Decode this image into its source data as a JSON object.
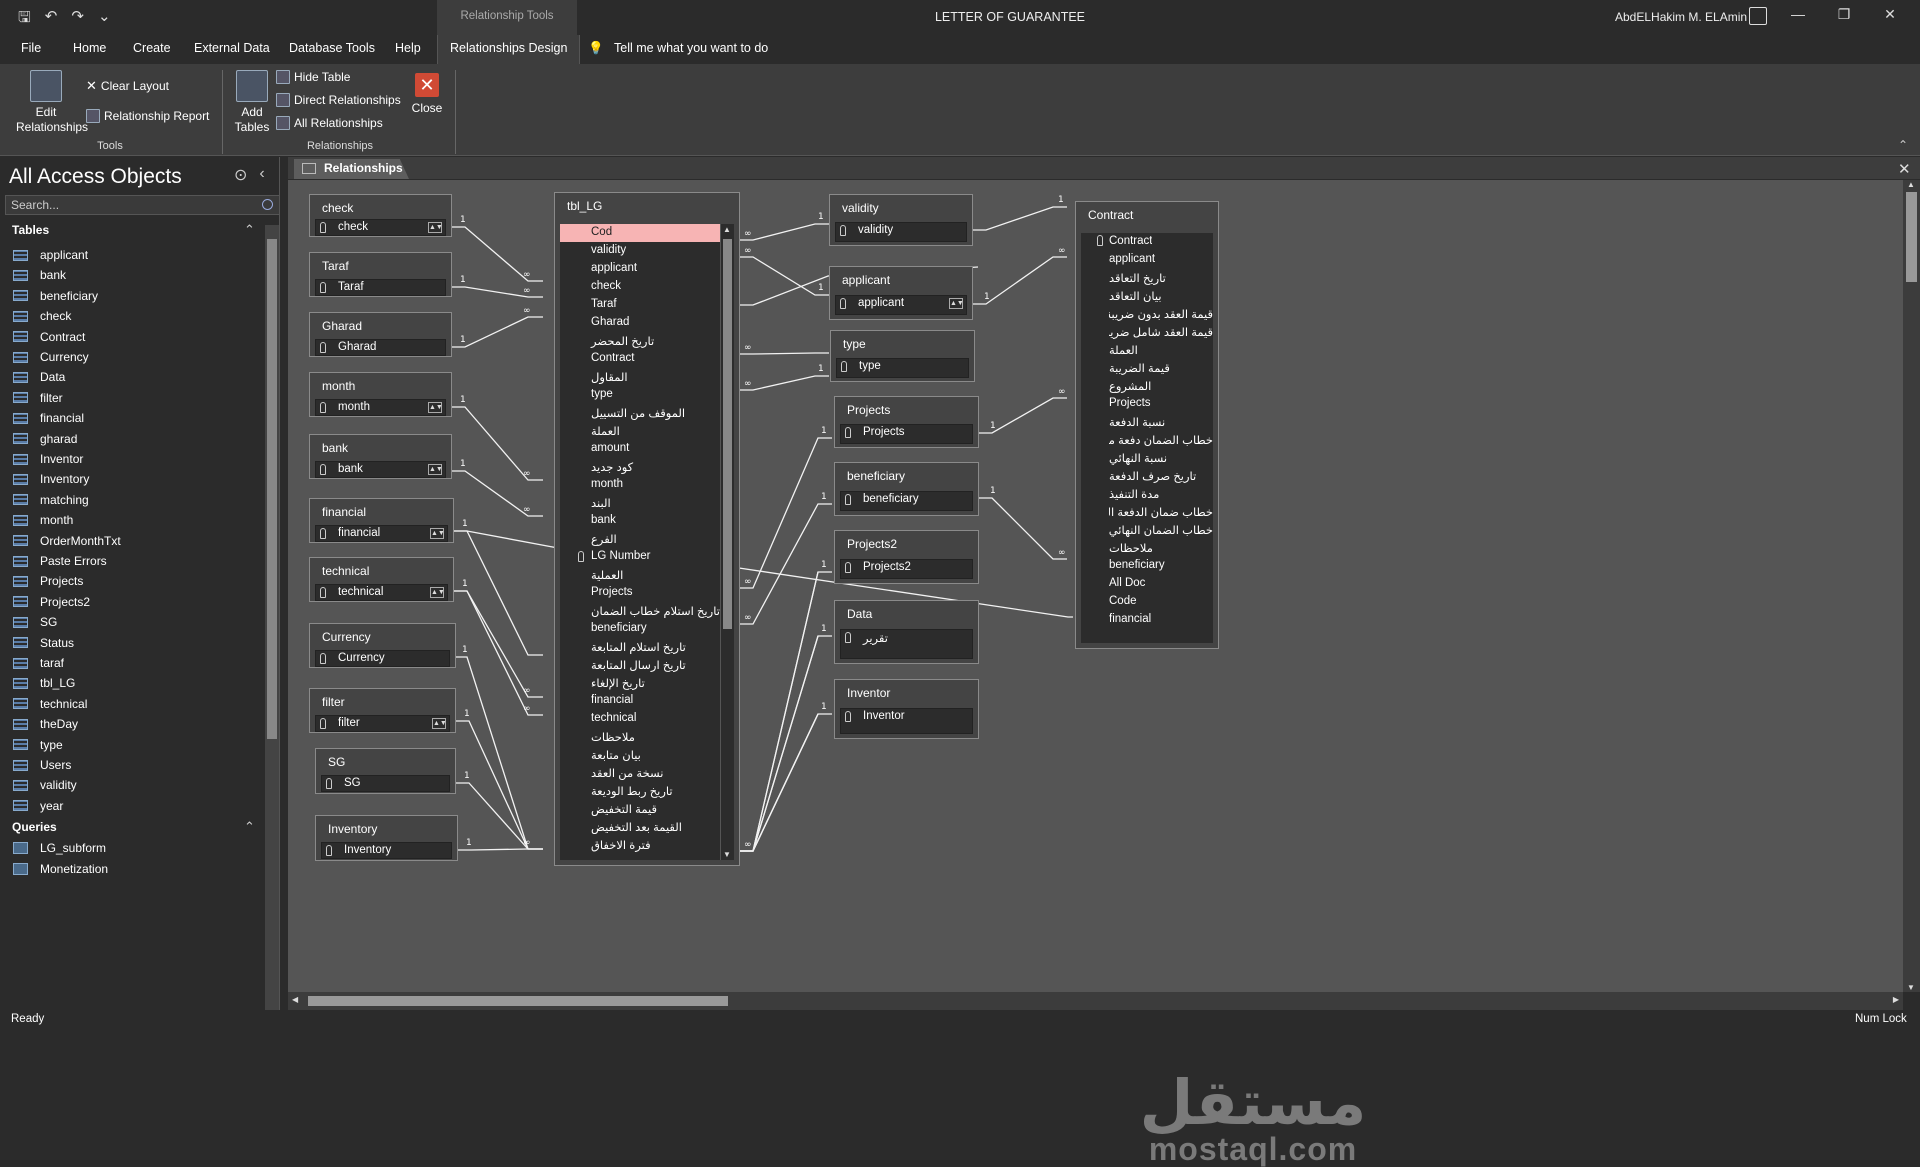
{
  "titlebar": {
    "contextual_tab": "Relationship Tools",
    "document_title": "LETTER OF GUARANTEE",
    "user_name": "AbdELHakim M. ELAmin"
  },
  "menu": {
    "items": [
      "File",
      "Home",
      "Create",
      "External Data",
      "Database Tools",
      "Help"
    ],
    "active": "Relationships Design",
    "tell_me": "Tell me what you want to do"
  },
  "ribbon": {
    "edit_relationships": "Edit Relationships",
    "clear_layout": "Clear Layout",
    "relationship_report": "Relationship Report",
    "tools_group": "Tools",
    "add_tables": "Add Tables",
    "hide_table": "Hide Table",
    "direct_relationships": "Direct Relationships",
    "all_relationships": "All Relationships",
    "close": "Close",
    "relationships_group": "Relationships"
  },
  "nav": {
    "title": "All Access Objects",
    "search_placeholder": "Search...",
    "tables_header": "Tables",
    "queries_header": "Queries",
    "tables": [
      "applicant",
      "bank",
      "beneficiary",
      "check",
      "Contract",
      "Currency",
      "Data",
      "filter",
      "financial",
      "gharad",
      "Inventor",
      "Inventory",
      "matching",
      "month",
      "OrderMonthTxt",
      "Paste Errors",
      "Projects",
      "Projects2",
      "SG",
      "Status",
      "taraf",
      "tbl_LG",
      "technical",
      "theDay",
      "type",
      "Users",
      "validity",
      "year"
    ],
    "queries": [
      "LG_subform",
      "Monetization"
    ]
  },
  "doc_tab": "Relationships",
  "boxes": {
    "check": {
      "title": "check",
      "field": "check"
    },
    "taraf": {
      "title": "Taraf",
      "field": "Taraf"
    },
    "gharad": {
      "title": "Gharad",
      "field": "Gharad"
    },
    "month": {
      "title": "month",
      "field": "month"
    },
    "bank": {
      "title": "bank",
      "field": "bank"
    },
    "financial": {
      "title": "financial",
      "field": "financial"
    },
    "technical": {
      "title": "technical",
      "field": "technical"
    },
    "currency": {
      "title": "Currency",
      "field": "Currency"
    },
    "filter": {
      "title": "filter",
      "field": "filter"
    },
    "sg": {
      "title": "SG",
      "field": "SG"
    },
    "inventory": {
      "title": "Inventory",
      "field": "Inventory"
    },
    "validity": {
      "title": "validity",
      "field": "validity"
    },
    "applicant": {
      "title": "applicant",
      "field": "applicant"
    },
    "type": {
      "title": "type",
      "field": "type"
    },
    "projects": {
      "title": "Projects",
      "field": "Projects"
    },
    "beneficiary": {
      "title": "beneficiary",
      "field": "beneficiary"
    },
    "projects2": {
      "title": "Projects2",
      "field": "Projects2"
    },
    "data": {
      "title": "Data",
      "field": "تقرير"
    },
    "inventor": {
      "title": "Inventor",
      "field": "Inventor"
    }
  },
  "tbl_lg": {
    "title": "tbl_LG",
    "fields": [
      "Cod",
      "validity",
      "applicant",
      "check",
      "Taraf",
      "Gharad",
      "تاريخ المحضر",
      "Contract",
      "المقاول",
      "type",
      "الموقف من التسييل",
      "العملة",
      "amount",
      "كود جديد",
      "month",
      "البند",
      "bank",
      "الفرع",
      "LG Number",
      "العملية",
      "Projects",
      "تاريخ استلام خطاب الضمان",
      "beneficiary",
      "تاريخ استلام المتابعة",
      "تاريخ ارسال المتابعة",
      "تاريخ الإلغاء",
      "financial",
      "technical",
      "ملاحظات",
      "بيان متابعة",
      "نسخة من العقد",
      "تاريخ ربط الوديعة",
      "قيمة التخفيض",
      "القيمة بعد التخفيض",
      "فترة الاخفاق"
    ]
  },
  "contract": {
    "title": "Contract",
    "fields": [
      "Contract",
      "applicant",
      "تاريخ التعاقد",
      "بيان التعاقد",
      "قيمة العقد بدون ضريبة المبيعات )",
      "قيمة العقد شامل ضريبة المبيعات )",
      "العملة",
      "قيمة الضريبة",
      "المشروع",
      "Projects",
      "نسبة الدفعة",
      "خطاب الضمان دفعة مقدمة",
      "نسبة النهائي",
      "تاريخ صرف الدفعة",
      "مدة التنفيذ",
      "خطاب ضمان الدفعة المقدمة",
      "خطاب الضمان النهائي",
      "ملاحظات",
      "beneficiary",
      "All Doc",
      "Code",
      "financial"
    ]
  },
  "status": {
    "left": "Ready",
    "right": "Num Lock"
  },
  "watermark": {
    "arabic": "مستقل",
    "latin": "mostaql.com"
  }
}
